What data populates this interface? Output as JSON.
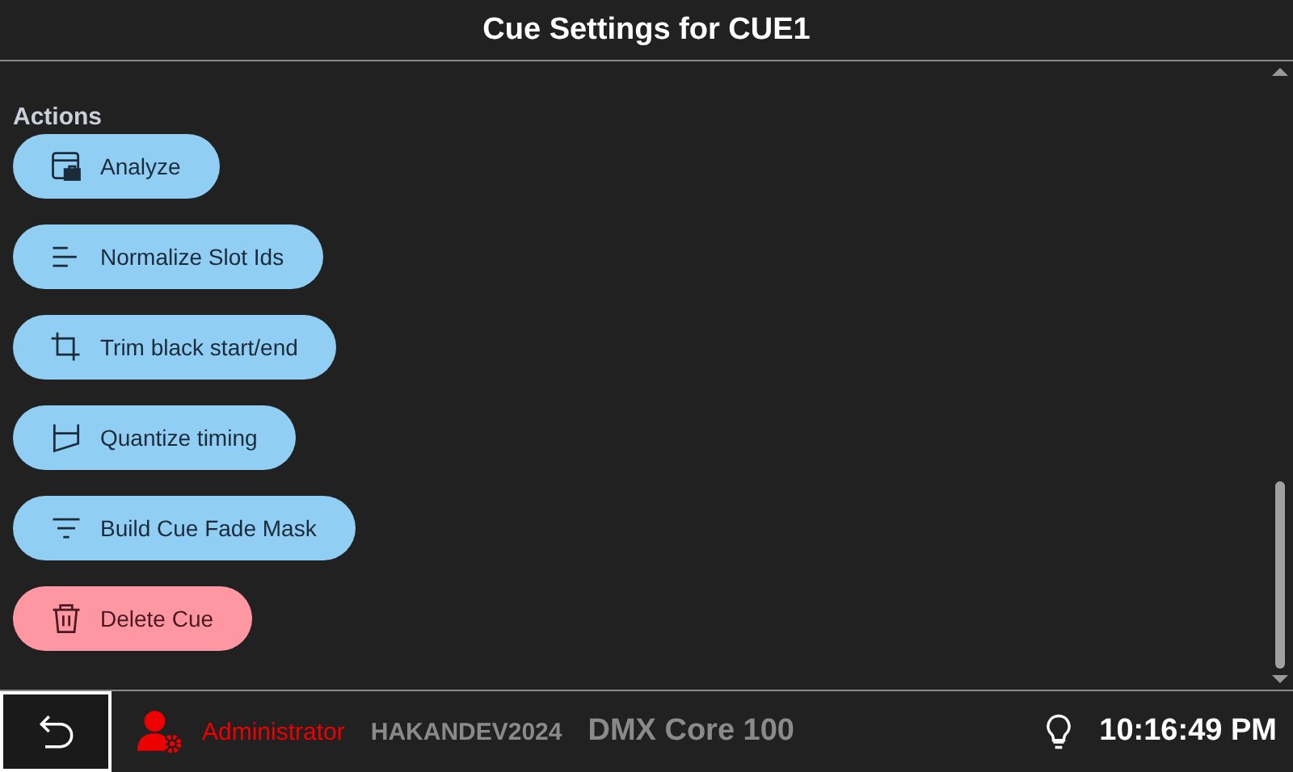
{
  "window": {
    "title": "Cue Settings for CUE1"
  },
  "section": {
    "title": "Actions"
  },
  "actions": [
    {
      "label": "Analyze",
      "kind": "analyze"
    },
    {
      "label": "Normalize Slot Ids",
      "kind": "lines"
    },
    {
      "label": "Trim black start/end",
      "kind": "crop"
    },
    {
      "label": "Quantize timing",
      "kind": "funnel"
    },
    {
      "label": "Build Cue Fade Mask",
      "kind": "filter"
    },
    {
      "label": "Delete Cue",
      "kind": "trash"
    }
  ],
  "status_bar": {
    "user": "Administrator",
    "host": "HAKANDEV2024",
    "device": "DMX Core 100",
    "time": "10:16:49 PM"
  }
}
